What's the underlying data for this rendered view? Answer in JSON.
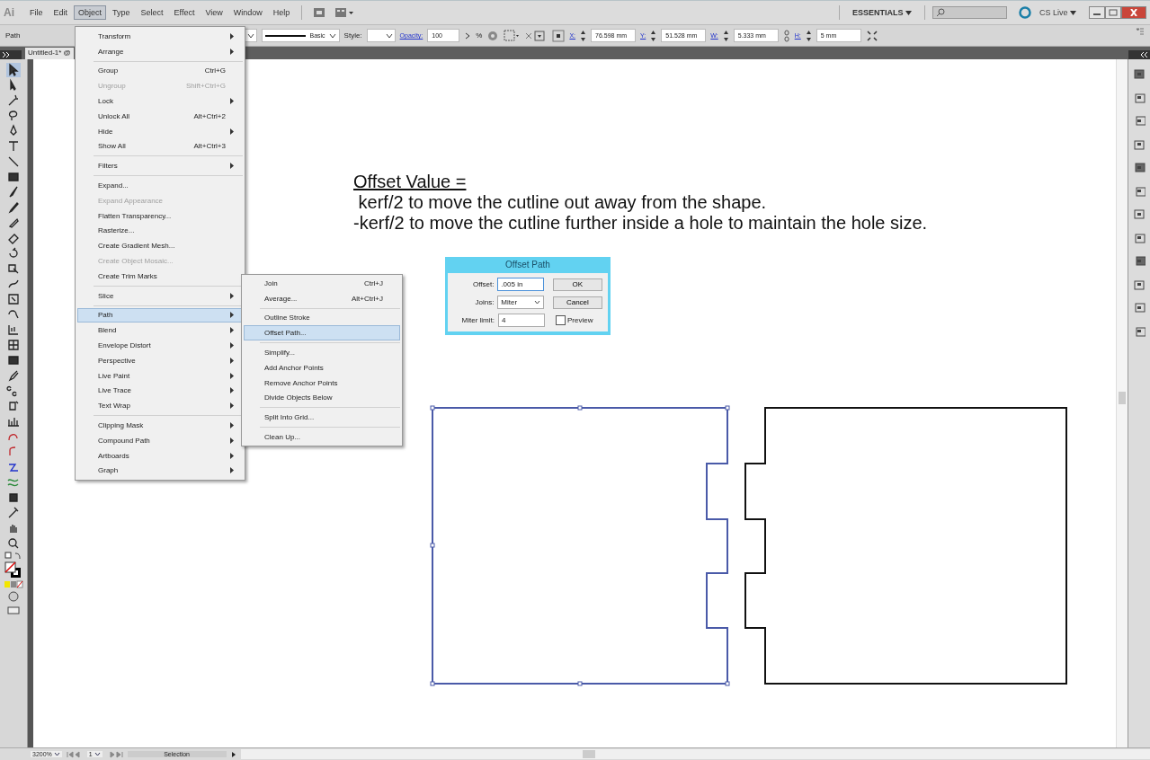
{
  "app_logo": "Ai",
  "menu_bar": [
    {
      "label": "File",
      "selected": false
    },
    {
      "label": "Edit",
      "selected": false
    },
    {
      "label": "Object",
      "selected": true
    },
    {
      "label": "Type",
      "selected": false
    },
    {
      "label": "Select",
      "selected": false
    },
    {
      "label": "Effect",
      "selected": false
    },
    {
      "label": "View",
      "selected": false
    },
    {
      "label": "Window",
      "selected": false
    },
    {
      "label": "Help",
      "selected": false
    }
  ],
  "workspace": "ESSENTIALS",
  "cs_live": "CS Live",
  "control_bar": {
    "selection": "Path",
    "stroke_style": "Basic",
    "style_label": "Style:",
    "opacity_label": "Opacity:",
    "opacity": "100",
    "percent": "%",
    "x_label": "X:",
    "x": "76.598 mm",
    "y_label": "Y:",
    "y": "51.528 mm",
    "w_label": "W:",
    "w": "5.333 mm",
    "h_label": "H:",
    "h": "5 mm"
  },
  "document_tab": "Untitled-1* @",
  "object_menu": [
    [
      {
        "label": "Transform",
        "submenu": true,
        "disabled": false,
        "selected": false
      },
      {
        "label": "Arrange",
        "submenu": true,
        "disabled": false,
        "selected": false
      }
    ],
    [
      {
        "label": "Group",
        "shortcut": "Ctrl+G",
        "submenu": false,
        "disabled": false,
        "selected": false
      },
      {
        "label": "Ungroup",
        "shortcut": "Shift+Ctrl+G",
        "submenu": false,
        "disabled": true,
        "selected": false
      },
      {
        "label": "Lock",
        "submenu": true,
        "disabled": false,
        "selected": false
      },
      {
        "label": "Unlock All",
        "shortcut": "Alt+Ctrl+2",
        "submenu": false,
        "disabled": false,
        "selected": false
      },
      {
        "label": "Hide",
        "submenu": true,
        "disabled": false,
        "selected": false
      },
      {
        "label": "Show All",
        "shortcut": "Alt+Ctrl+3",
        "submenu": false,
        "disabled": false,
        "selected": false
      }
    ],
    [
      {
        "label": "Filters",
        "submenu": true,
        "disabled": false,
        "selected": false
      }
    ],
    [
      {
        "label": "Expand...",
        "submenu": false,
        "disabled": false,
        "selected": false
      },
      {
        "label": "Expand Appearance",
        "submenu": false,
        "disabled": true,
        "selected": false
      },
      {
        "label": "Flatten Transparency...",
        "submenu": false,
        "disabled": false,
        "selected": false
      },
      {
        "label": "Rasterize...",
        "submenu": false,
        "disabled": false,
        "selected": false
      },
      {
        "label": "Create Gradient Mesh...",
        "submenu": false,
        "disabled": false,
        "selected": false
      },
      {
        "label": "Create Object Mosaic...",
        "submenu": false,
        "disabled": true,
        "selected": false
      },
      {
        "label": "Create Trim Marks",
        "submenu": false,
        "disabled": false,
        "selected": false
      }
    ],
    [
      {
        "label": "Slice",
        "submenu": true,
        "disabled": false,
        "selected": false
      }
    ],
    [
      {
        "label": "Path",
        "submenu": true,
        "disabled": false,
        "selected": true
      },
      {
        "label": "Blend",
        "submenu": true,
        "disabled": false,
        "selected": false
      },
      {
        "label": "Envelope Distort",
        "submenu": true,
        "disabled": false,
        "selected": false
      },
      {
        "label": "Perspective",
        "submenu": true,
        "disabled": false,
        "selected": false
      },
      {
        "label": "Live Paint",
        "submenu": true,
        "disabled": false,
        "selected": false
      },
      {
        "label": "Live Trace",
        "submenu": true,
        "disabled": false,
        "selected": false
      },
      {
        "label": "Text Wrap",
        "submenu": true,
        "disabled": false,
        "selected": false
      }
    ],
    [
      {
        "label": "Clipping Mask",
        "submenu": true,
        "disabled": false,
        "selected": false
      },
      {
        "label": "Compound Path",
        "submenu": true,
        "disabled": false,
        "selected": false
      },
      {
        "label": "Artboards",
        "submenu": true,
        "disabled": false,
        "selected": false
      },
      {
        "label": "Graph",
        "submenu": true,
        "disabled": false,
        "selected": false
      }
    ]
  ],
  "path_submenu": [
    [
      {
        "label": "Join",
        "shortcut": "Ctrl+J",
        "selected": false
      },
      {
        "label": "Average...",
        "shortcut": "Alt+Ctrl+J",
        "selected": false
      }
    ],
    [
      {
        "label": "Outline Stroke",
        "selected": false
      },
      {
        "label": "Offset Path...",
        "selected": true
      }
    ],
    [
      {
        "label": "Simplify...",
        "selected": false
      },
      {
        "label": "Add Anchor Points",
        "selected": false
      },
      {
        "label": "Remove Anchor Points",
        "selected": false
      },
      {
        "label": "Divide Objects Below",
        "selected": false
      }
    ],
    [
      {
        "label": "Split Into Grid...",
        "selected": false
      }
    ],
    [
      {
        "label": "Clean Up...",
        "selected": false
      }
    ]
  ],
  "canvas_note": {
    "heading": "Offset Value =",
    "lines": [
      " kerf/2 to move the cutline out away from the shape.",
      "-kerf/2 to move the cutline further inside a hole to maintain the hole size."
    ]
  },
  "offset_dialog": {
    "title": "Offset Path",
    "offset_label": "Offset:",
    "offset": ".005 in",
    "joins_label": "Joins:",
    "joins": "Miter",
    "miter_label": "Miter limit:",
    "miter": "4",
    "ok": "OK",
    "cancel": "Cancel",
    "preview": {
      "label": "Preview",
      "checked": false
    }
  },
  "shapes": [
    {
      "kind": "notched",
      "selected": true
    },
    {
      "kind": "tabbed",
      "selected": false
    }
  ],
  "status_bar": {
    "zoom": "3200%",
    "page": "1",
    "tool": "Selection"
  }
}
